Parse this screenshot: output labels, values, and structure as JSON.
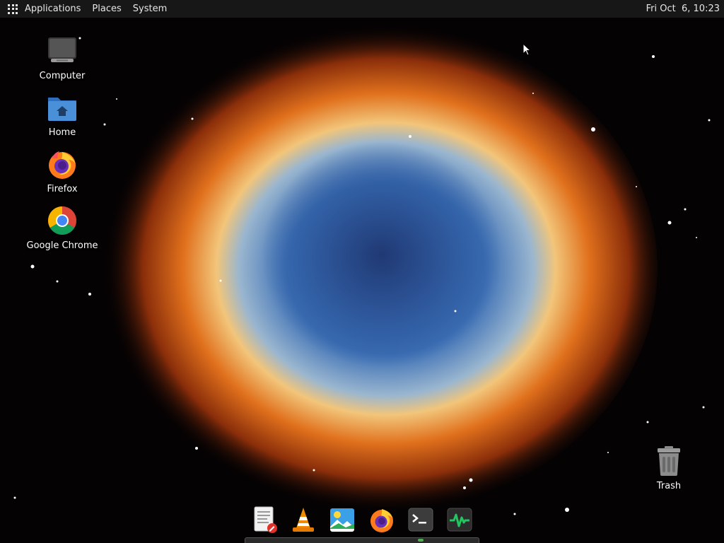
{
  "top_panel": {
    "menus": [
      "Applications",
      "Places",
      "System"
    ],
    "clock": "Fri Oct  6, 10:23"
  },
  "desktop_icons": {
    "computer": "Computer",
    "home": "Home",
    "firefox": "Firefox",
    "chrome": "Google Chrome",
    "trash": "Trash"
  },
  "dock": {
    "items": [
      "text-editor-icon",
      "vlc-icon",
      "image-viewer-icon",
      "firefox-icon",
      "terminal-icon",
      "system-monitor-icon"
    ]
  },
  "colors": {
    "panel_bg": "#171717",
    "folder_blue": "#4a90d9",
    "vlc_orange": "#f08a00",
    "monitor_green": "#22c55e"
  }
}
